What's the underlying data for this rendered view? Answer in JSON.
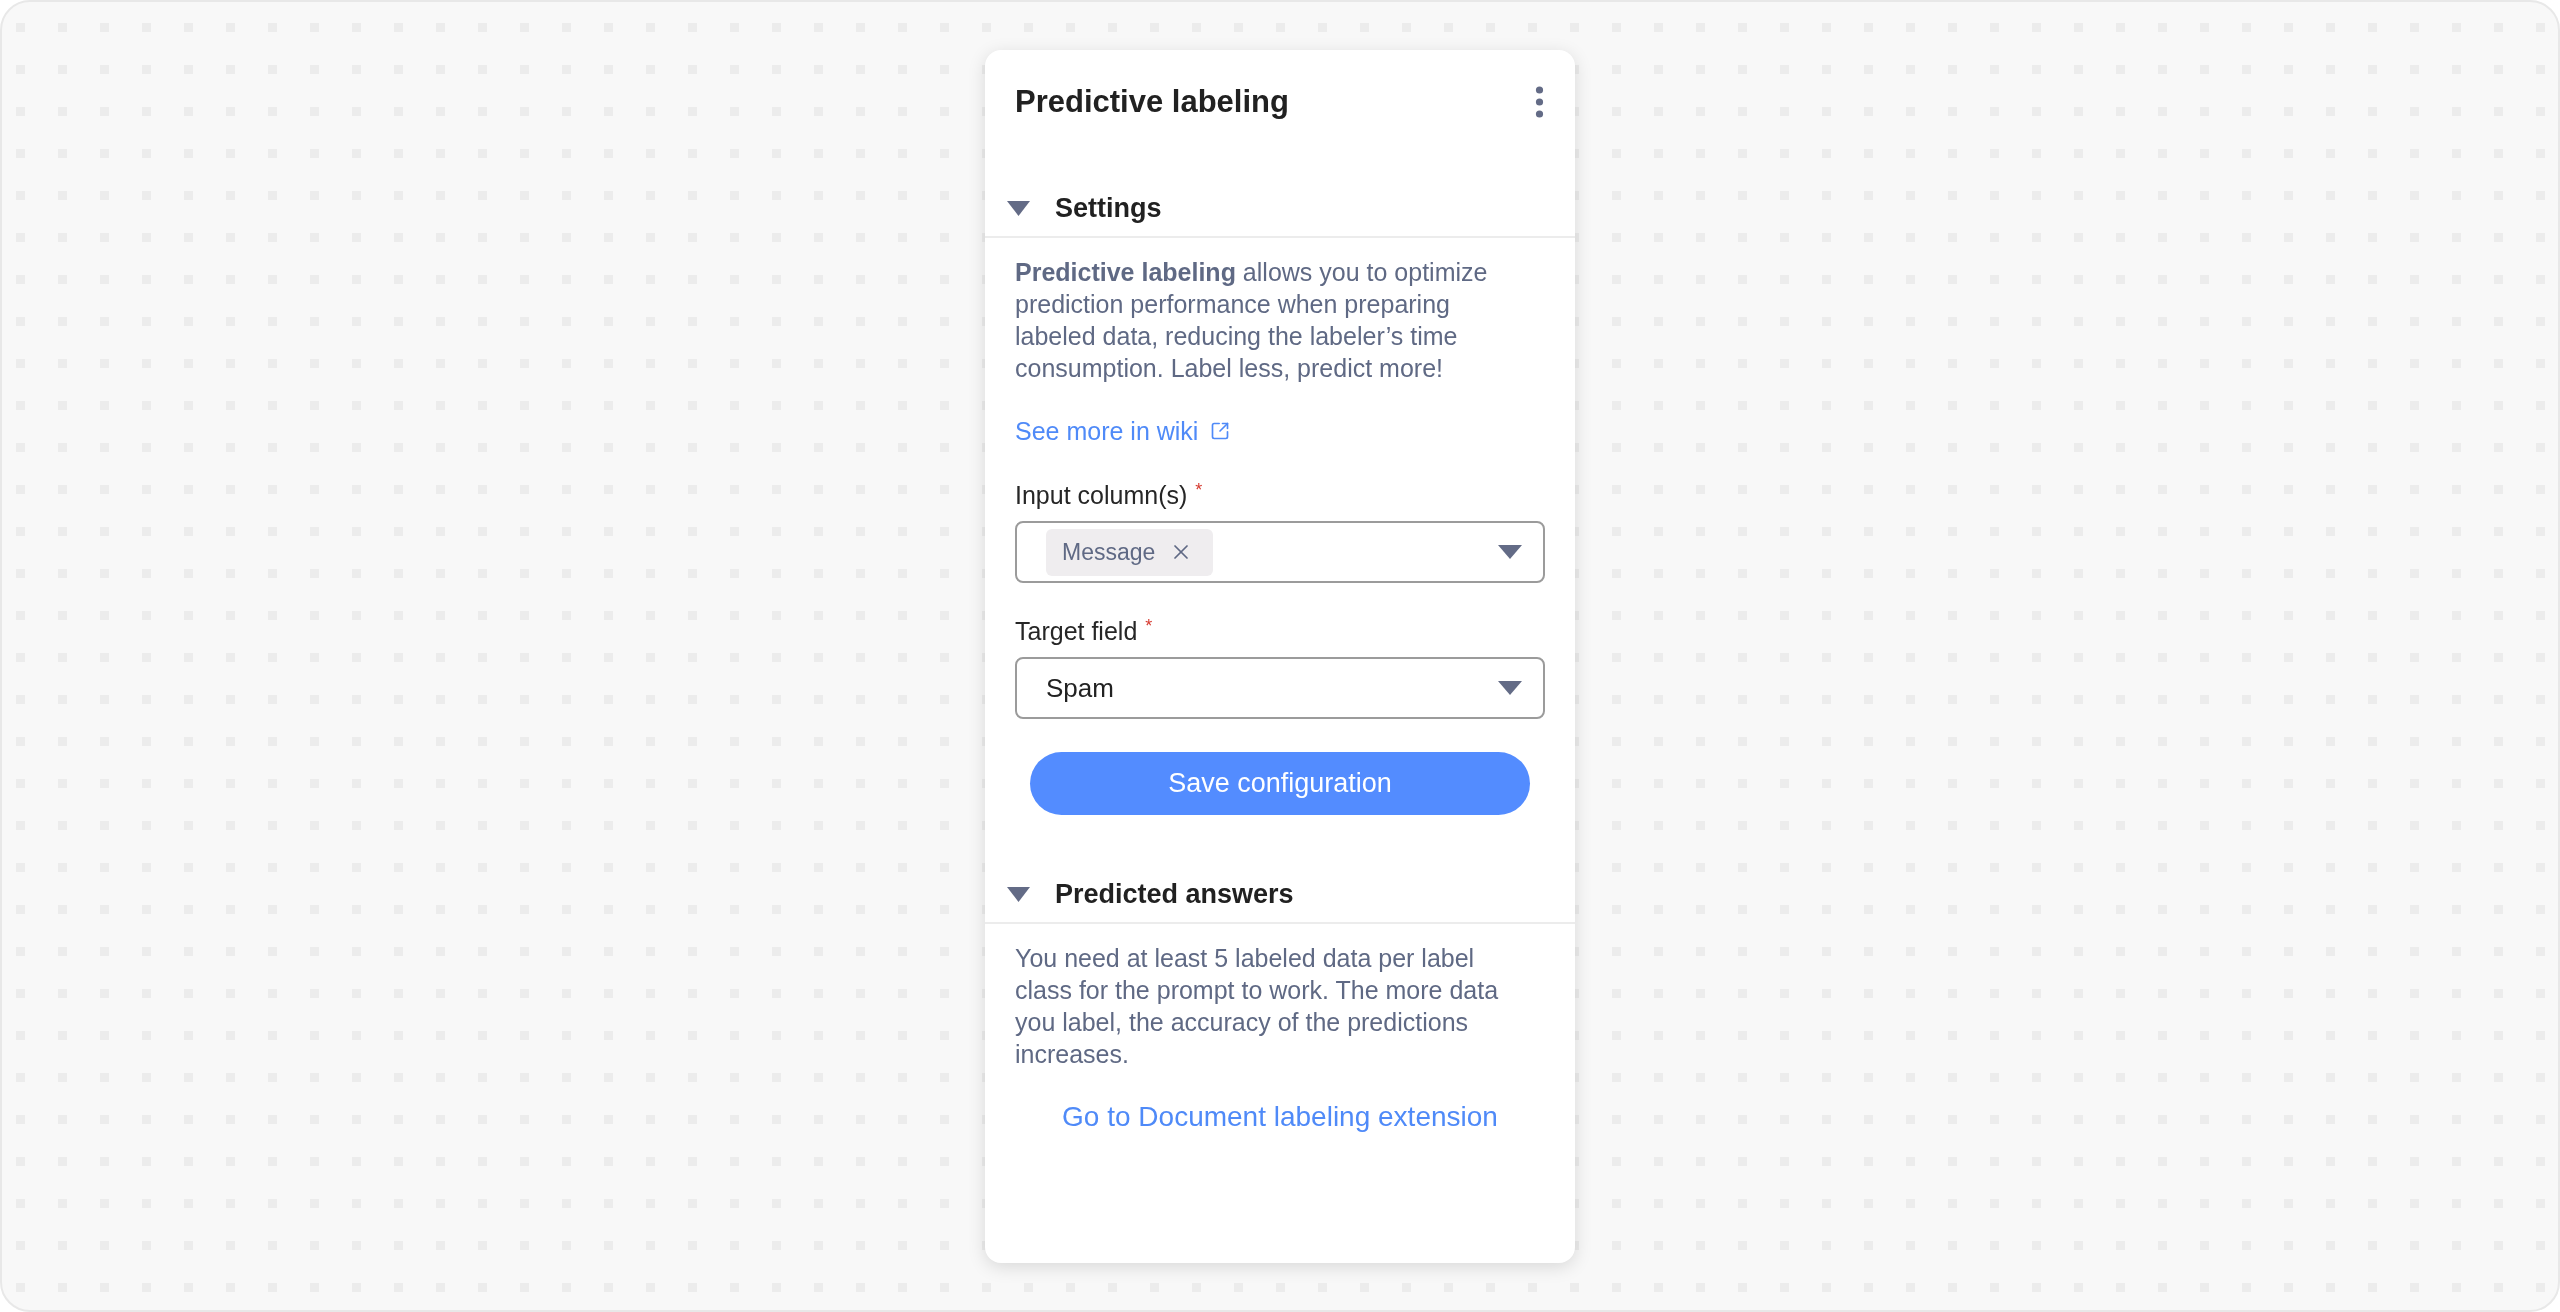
{
  "panel": {
    "title": "Predictive labeling"
  },
  "sections": [
    {
      "title": "Settings",
      "expanded": true,
      "description": "**Predictive labeling** allows you to optimize prediction performance when preparing labeled data, reducing the labeler’s time consumption. Label less, predict more!",
      "link": {
        "label": "See more in wiki",
        "external": true
      },
      "fields": [
        {
          "kind": "multiselect",
          "label": "Input column(s)",
          "required_mark": "*",
          "chips": [
            "Message"
          ]
        },
        {
          "kind": "select",
          "label": "Target field",
          "required_mark": "*",
          "value": "Spam"
        }
      ],
      "button": "Save configuration"
    },
    {
      "title": "Predicted answers",
      "expanded": true,
      "description": "You need at least 5 labeled data per label class for the prompt to work. The more data you label, the accuracy of the predictions increases.",
      "action_link": "Go to Document labeling extension"
    }
  ]
}
